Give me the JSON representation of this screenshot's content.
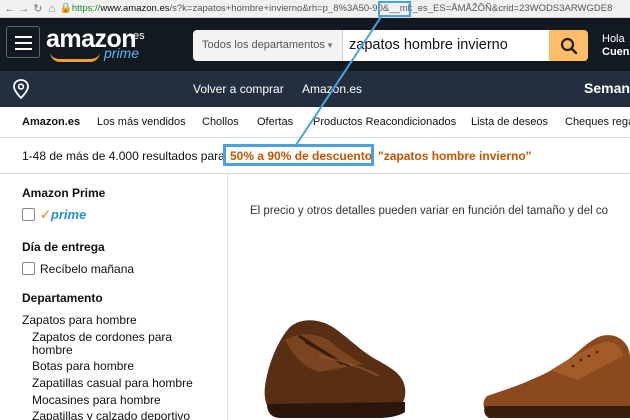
{
  "browser": {
    "url_scheme": "https://",
    "url_host": "www.amazon.es",
    "url_rest": "/s?k=zapatos+hombre+invierno&rh=p_8%3A50-90&__mk_es_ES=ÅMÅŽÕÑ&crid=23WODS3ARWGDE8"
  },
  "header": {
    "logo_text": "amazon",
    "logo_suffix": ".es",
    "logo_prime": "prime",
    "search_dept": "Todos los departamentos",
    "search_query": "zapatos hombre invierno",
    "account_line1": "Hola",
    "account_line2": "Cuen"
  },
  "subheader": {
    "link1": "Volver a comprar",
    "link2": "Amazon.es",
    "right_text": "Seman"
  },
  "nav": {
    "items": [
      "Amazon.es",
      "Los más vendidos",
      "Chollos",
      "Ofertas",
      "Productos Reacondicionados",
      "Lista de deseos",
      "Cheques rega"
    ]
  },
  "results": {
    "count_text": "1-48 de más de 4.000 resultados para",
    "filter": "50% a 90% de descuento",
    "query": "\"zapatos hombre invierno\""
  },
  "sidebar": {
    "prime_heading": "Amazon Prime",
    "prime_label": "prime",
    "delivery_heading": "Día de entrega",
    "delivery_option": "Recíbelo mañana",
    "department_heading": "Departamento",
    "department_root": "Zapatos para hombre",
    "subcategories": [
      "Zapatos de cordones para hombre",
      "Botas para hombre",
      "Zapatillas casual para hombre",
      "Mocasines para hombre",
      "Zapatillas y calzado deportivo"
    ]
  },
  "main": {
    "price_note": "El precio y otros detalles pueden variar en función del tamaño y del co"
  },
  "colors": {
    "header_bg": "#131921",
    "subheader_bg": "#232f3e",
    "search_button": "#febd69",
    "highlight_blue": "#4aa3df",
    "result_orange": "#c45500"
  }
}
